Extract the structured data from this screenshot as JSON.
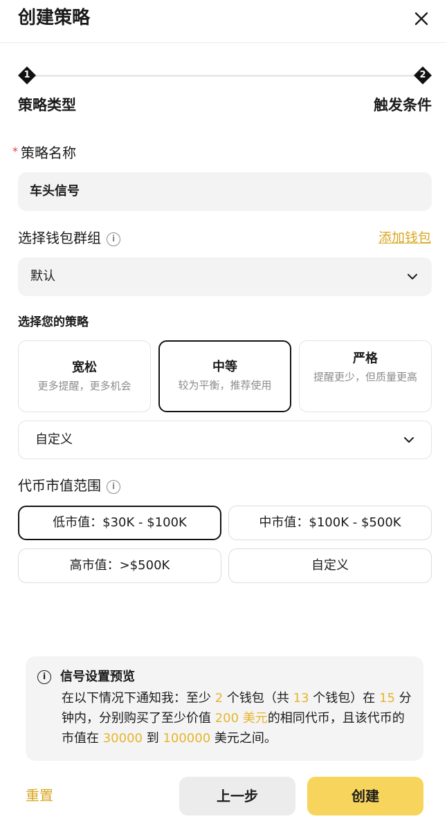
{
  "header": {
    "title": "创建策略"
  },
  "stepper": {
    "steps": [
      {
        "num": "1",
        "label": "策略类型"
      },
      {
        "num": "2",
        "label": "触发条件"
      }
    ]
  },
  "name_field": {
    "required_mark": "*",
    "label": "策略名称",
    "value": "车头信号"
  },
  "wallet_group": {
    "label": "选择钱包群组",
    "add_link": "添加钱包",
    "selected": "默认"
  },
  "strategy": {
    "label": "选择您的策略",
    "cards": [
      {
        "title": "宽松",
        "desc": "更多提醒，更多机会"
      },
      {
        "title": "中等",
        "desc": "较为平衡，推荐使用"
      },
      {
        "title": "严格",
        "desc": "提醒更少，但质量更高"
      }
    ],
    "custom": "自定义"
  },
  "market_cap": {
    "label": "代币市值范围",
    "options": [
      "低市值：$30K - $100K",
      "中市值：$100K - $500K",
      "高市值：>$500K",
      "自定义"
    ]
  },
  "preview": {
    "title": "信号设置预览",
    "t1": "在以下情况下通知我：至少 ",
    "min_wallets": "2",
    "t2": " 个钱包（共 ",
    "total_wallets": "13",
    "t3": " 个钱包）在 ",
    "minutes": "15",
    "t4": " 分钟内，分别购买了至少价值 ",
    "amount": "200 美元",
    "t5": "的相同代币，且该代币的市值在 ",
    "cap_min": "30000",
    "t6": " 到 ",
    "cap_max": "100000",
    "t7": " 美元之间。"
  },
  "footer": {
    "reset": "重置",
    "prev": "上一步",
    "create": "创建"
  },
  "colors": {
    "accent": "#f7d55c",
    "link": "#d9a620",
    "highlight": "#e6b62e"
  }
}
